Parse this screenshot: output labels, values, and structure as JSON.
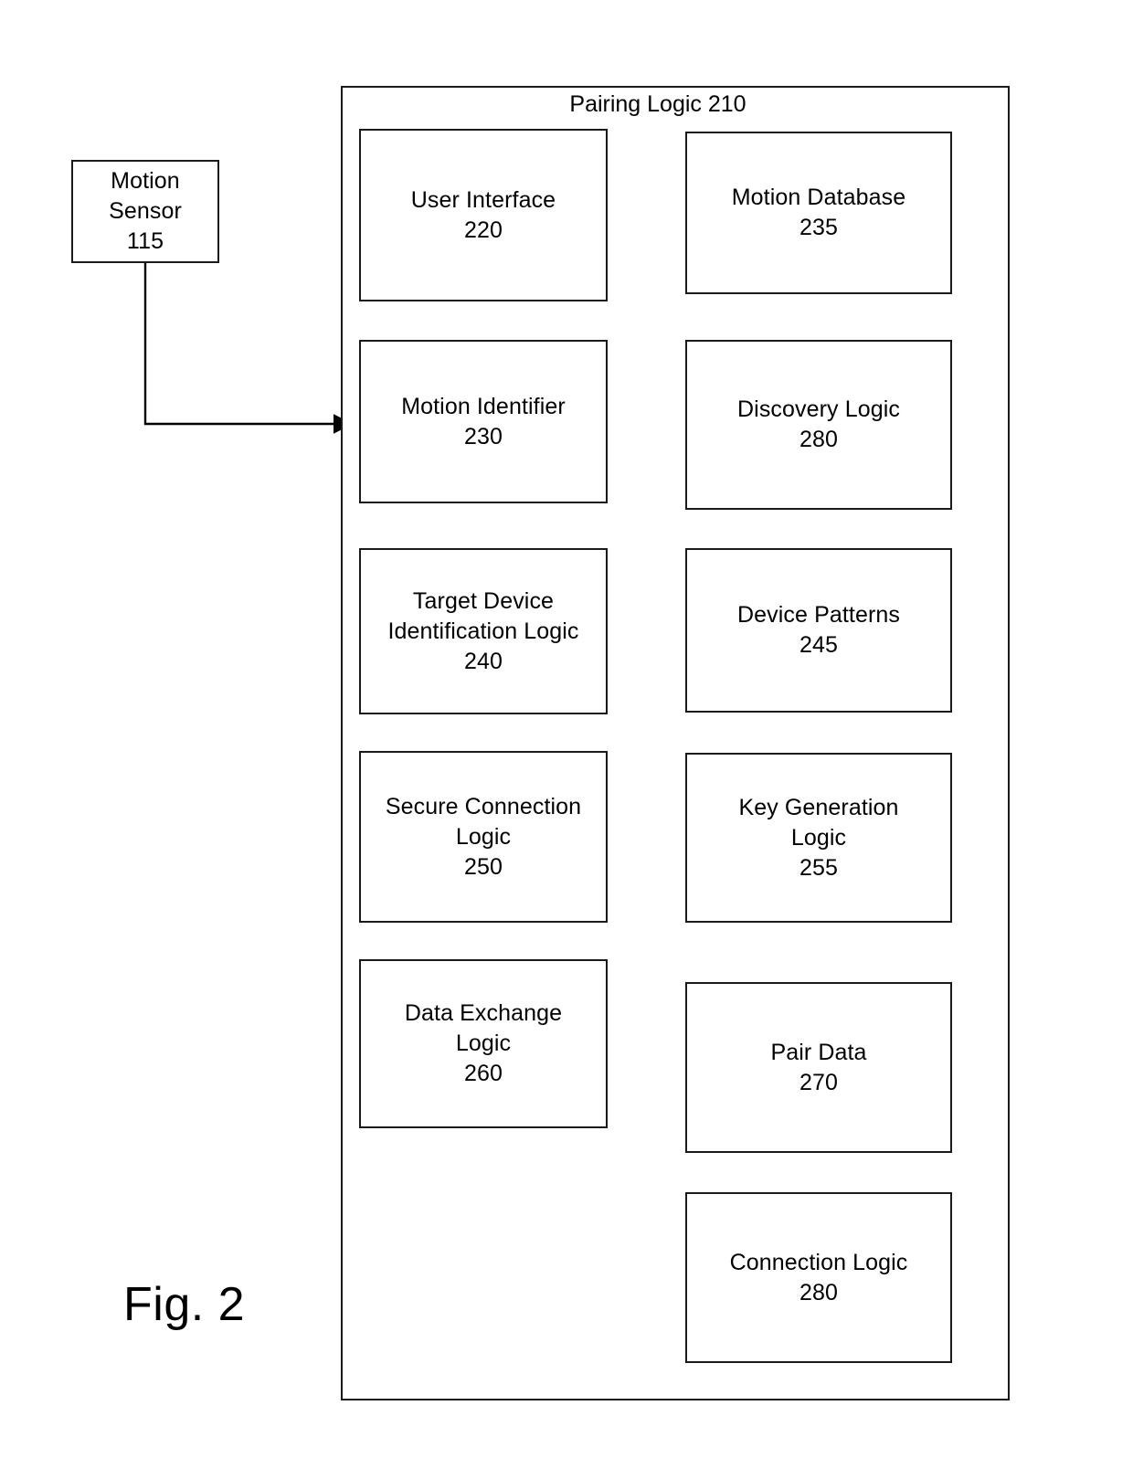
{
  "figure": {
    "label": "Fig. 2",
    "container_title": "Pairing Logic",
    "container_ref": "210"
  },
  "blocks": {
    "motion_sensor": {
      "title": "Motion",
      "title2": "Sensor",
      "ref": "115"
    },
    "user_interface": {
      "title": "User Interface",
      "ref": "220"
    },
    "motion_database": {
      "title": "Motion Database",
      "ref": "235"
    },
    "motion_identifier": {
      "title": "Motion Identifier",
      "ref": "230"
    },
    "discovery_logic": {
      "title": "Discovery Logic",
      "ref": "280"
    },
    "target_device_identification_logic": {
      "title": "Target Device",
      "title2": "Identification Logic",
      "ref": "240"
    },
    "device_patterns": {
      "title": "Device Patterns",
      "ref": "245"
    },
    "secure_connection_logic": {
      "title": "Secure Connection",
      "title2": "Logic",
      "ref": "250"
    },
    "key_generation_logic": {
      "title": "Key Generation",
      "title2": "Logic",
      "ref": "255"
    },
    "data_exchange_logic": {
      "title": "Data Exchange",
      "title2": "Logic",
      "ref": "260"
    },
    "pair_data": {
      "title": "Pair Data",
      "ref": "270"
    },
    "connection_logic": {
      "title": "Connection Logic",
      "ref": "280"
    }
  },
  "colors": {
    "stroke": "#1a1a1a",
    "background": "#ffffff",
    "text": "#000000"
  }
}
